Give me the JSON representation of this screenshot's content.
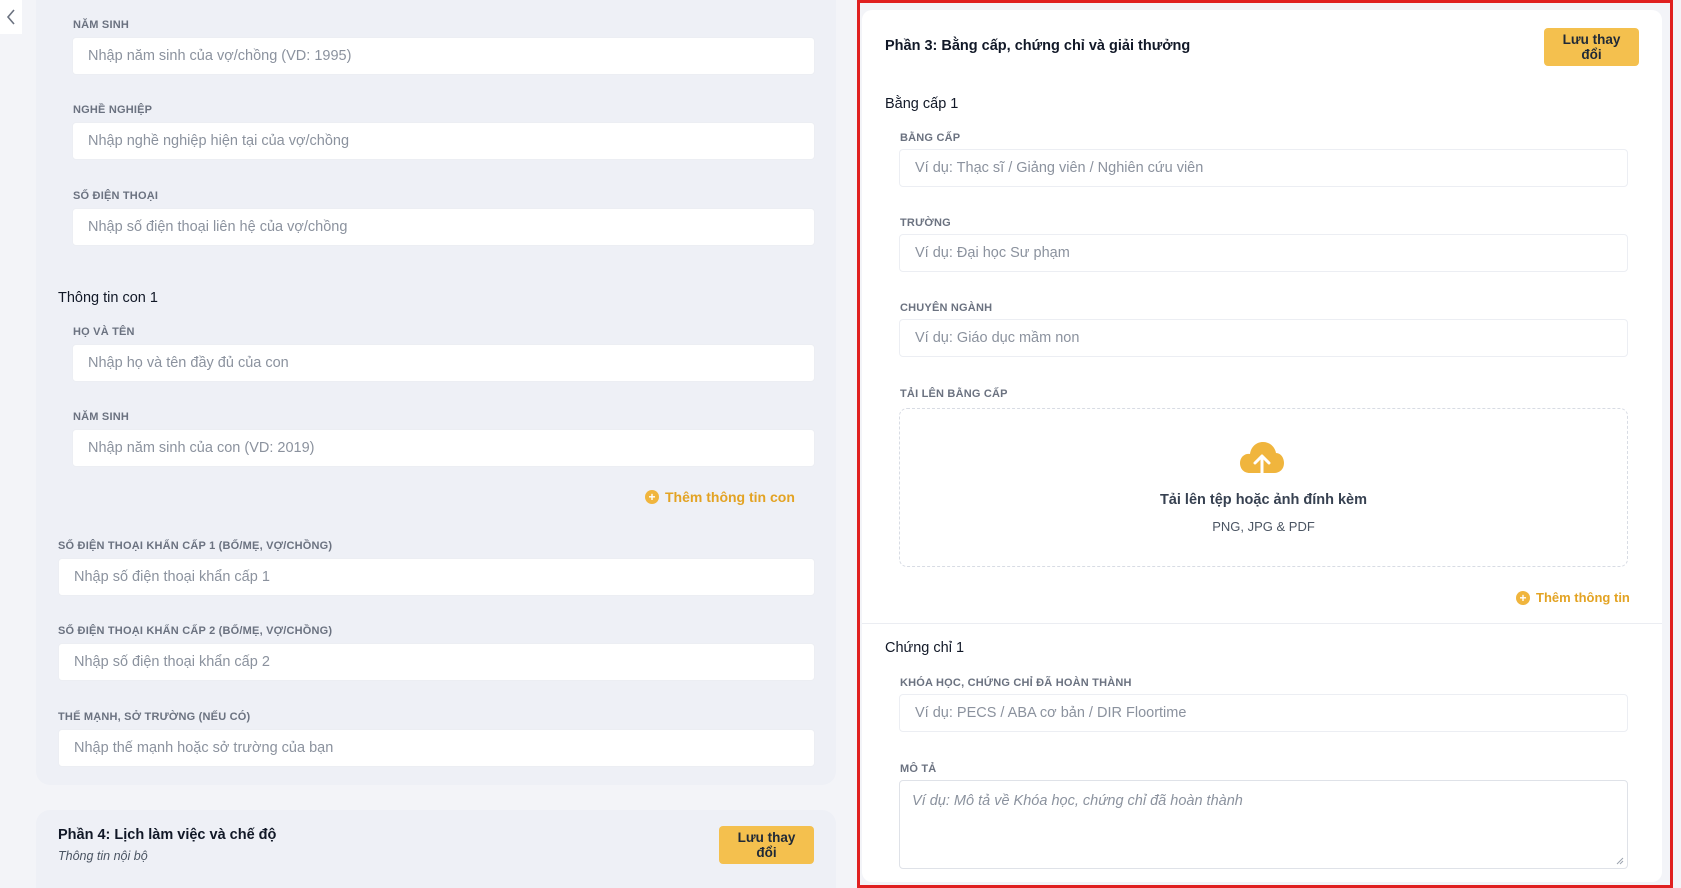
{
  "left": {
    "spouse_birth_year": {
      "label": "NĂM SINH",
      "placeholder": "Nhập năm sinh của vợ/chồng (VD: 1995)"
    },
    "spouse_job": {
      "label": "NGHỀ NGHIỆP",
      "placeholder": "Nhập nghề nghiệp hiện tại của vợ/chồng"
    },
    "spouse_phone": {
      "label": "SỐ ĐIỆN THOẠI",
      "placeholder": "Nhập số điện thoại liên hệ của vợ/chồng"
    },
    "child_group_title": "Thông tin con 1",
    "child_name": {
      "label": "HỌ VÀ TÊN",
      "placeholder": "Nhập họ và tên đầy đủ của con"
    },
    "child_birth_year": {
      "label": "NĂM SINH",
      "placeholder": "Nhập năm sinh của con (VD: 2019)"
    },
    "add_child_label": "Thêm thông tin con",
    "emergency_phone_1": {
      "label": "SỐ ĐIỆN THOẠI KHẨN CẤP 1 (BỐ/MẸ, VỢ/CHỒNG)",
      "placeholder": "Nhập số điện thoại khẩn cấp 1"
    },
    "emergency_phone_2": {
      "label": "SỐ ĐIỆN THOẠI KHẨN CẤP 2 (BỐ/MẸ, VỢ/CHỒNG)",
      "placeholder": "Nhập số điện thoại khẩn cấp 2"
    },
    "strengths": {
      "label": "THẾ MẠNH, SỞ TRƯỜNG (NẾU CÓ)",
      "placeholder": "Nhập thế mạnh hoặc sở trường của bạn"
    },
    "section4": {
      "title": "Phần 4: Lịch làm việc và chế độ",
      "subtitle": "Thông tin nội bộ",
      "save_label": "Lưu thay đổi"
    }
  },
  "right": {
    "section3_title": "Phần 3: Bằng cấp, chứng chỉ và giải thưởng",
    "save_label": "Lưu thay đổi",
    "degree_group_title": "Bằng cấp 1",
    "degree": {
      "label": "BẰNG CẤP",
      "placeholder": "Ví dụ: Thạc sĩ / Giảng viên / Nghiên cứu viên"
    },
    "school": {
      "label": "TRƯỜNG",
      "placeholder": "Ví dụ: Đại học Sư phạm"
    },
    "major": {
      "label": "CHUYÊN NGÀNH",
      "placeholder": "Ví dụ: Giáo dục mầm non"
    },
    "upload": {
      "label": "TẢI LÊN BẰNG CẤP",
      "title": "Tải lên tệp hoặc ảnh đính kèm",
      "formats": "PNG, JPG & PDF"
    },
    "add_info_label": "Thêm thông tin",
    "cert_group_title": "Chứng chỉ 1",
    "course": {
      "label": "KHÓA HỌC, CHỨNG CHỈ ĐÃ HOÀN THÀNH",
      "placeholder": "Ví dụ: PECS / ABA cơ bản / DIR Floortime"
    },
    "description": {
      "label": "MÔ TẢ",
      "placeholder": "Ví dụ: Mô tả về Khóa học, chứng chỉ đã hoàn thành"
    }
  },
  "icons": {
    "back": "chevron-left-icon",
    "add": "plus-circle-icon",
    "upload": "cloud-upload-icon"
  },
  "colors": {
    "accent": "#f4c04e",
    "accent_text": "#e3a323",
    "highlight_border": "#e02020"
  }
}
